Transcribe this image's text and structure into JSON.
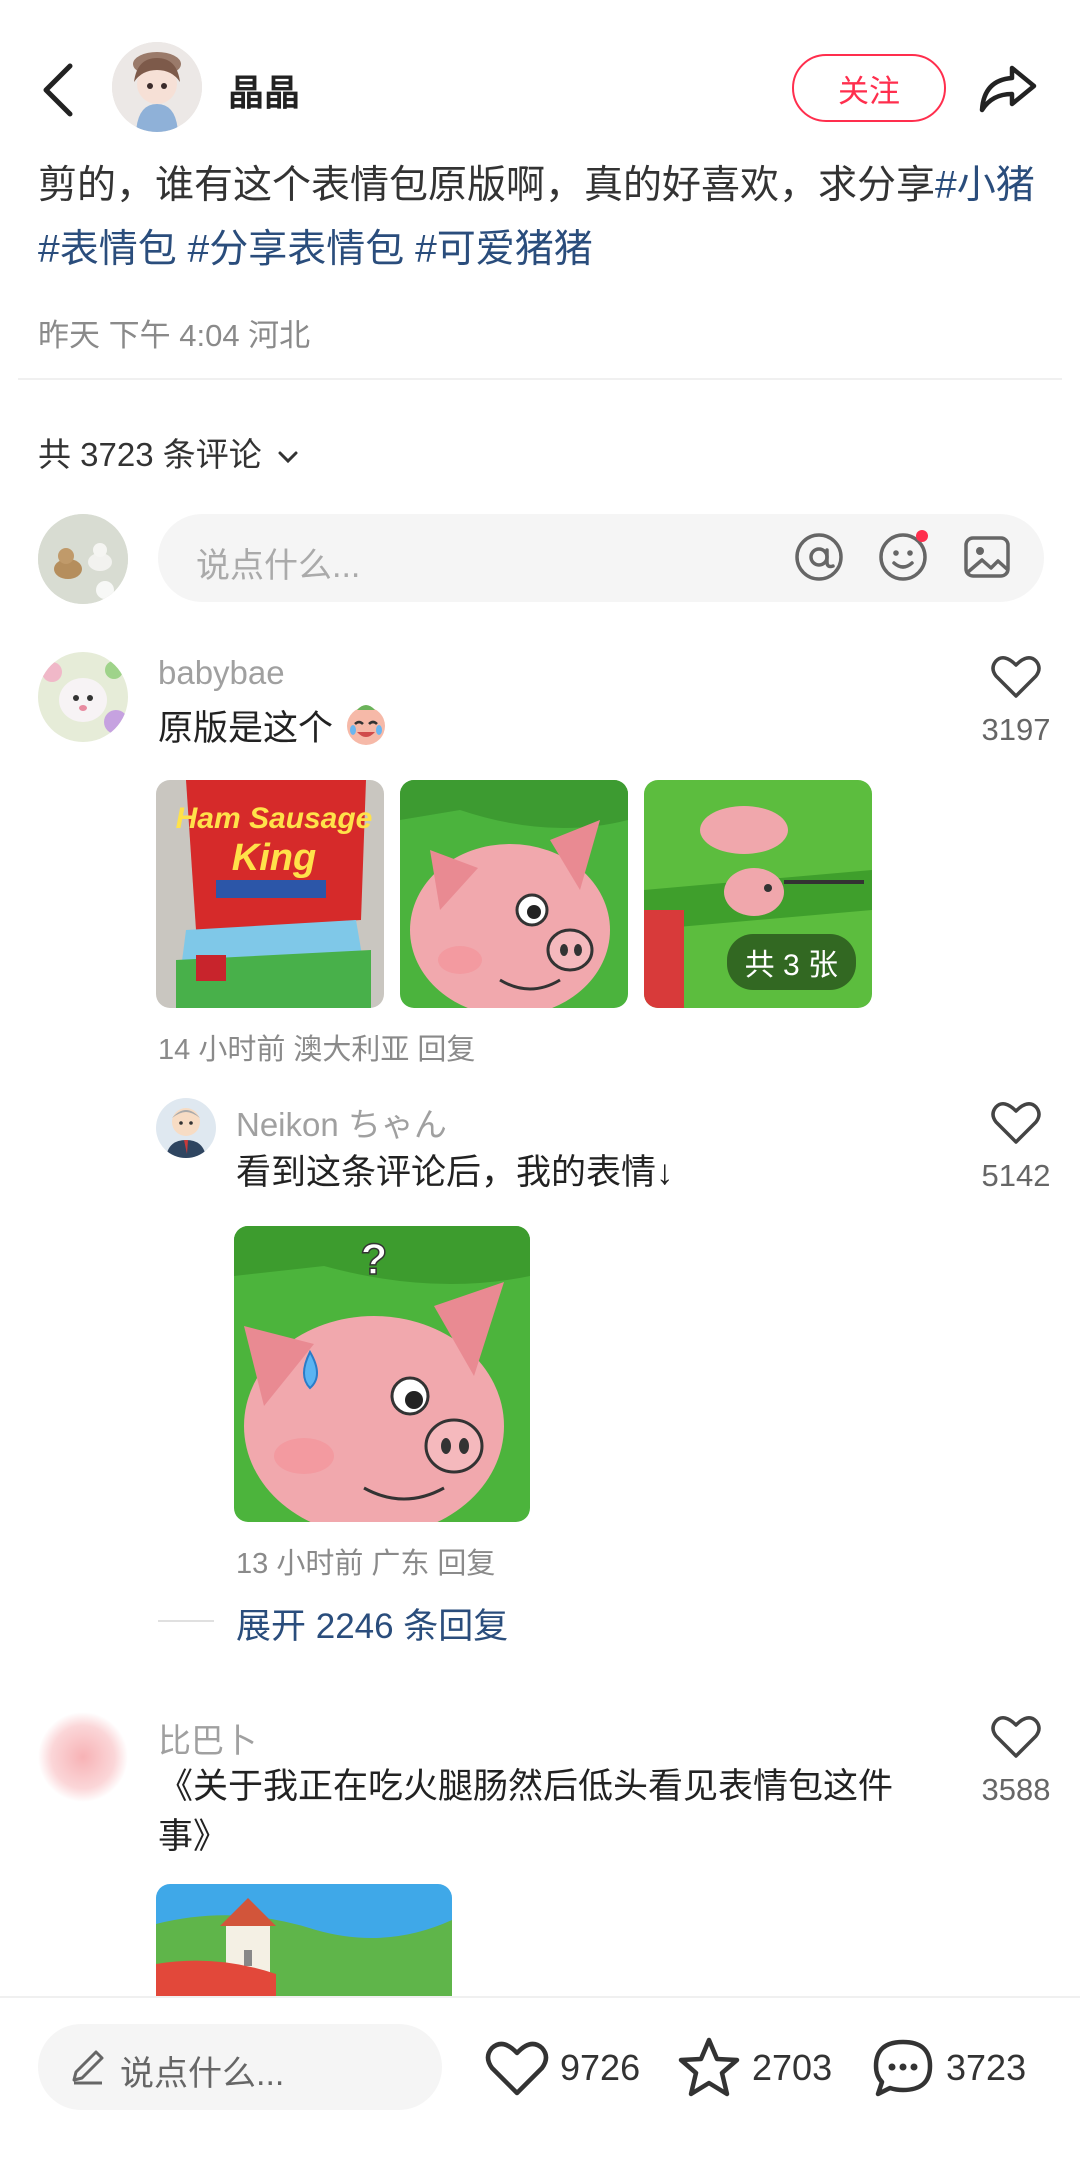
{
  "header": {
    "author_name": "晶晶",
    "follow_label": "关注",
    "back_icon": "back-chevron-icon",
    "share_icon": "share-arrow-icon"
  },
  "post": {
    "text": "剪的，谁有这个表情包原版啊，真的好喜欢，求分享",
    "tags": [
      "#小猪",
      "#表情包",
      "#分享表情包",
      "#可爱猪猪"
    ],
    "meta": "昨天 下午 4:04 河北"
  },
  "comments_header": {
    "count_label": "共 3723 条评论",
    "input_placeholder": "说点什么..."
  },
  "comments": [
    {
      "user": "babybae",
      "text": "原版是这个",
      "likes": "3197",
      "meta": "14 小时前 澳大利亚 回复",
      "images_badge": "共 3 张",
      "images": [
        {
          "name": "ham-sausage-package",
          "label_top": "Ham Sausage",
          "label_bottom": "King"
        },
        {
          "name": "pink-pig-closeup"
        },
        {
          "name": "pig-package-side"
        }
      ]
    },
    {
      "user": "Neikon ちゃん",
      "text": "看到这条评论后，我的表情↓",
      "likes": "5142",
      "meta": "13 小时前 广东 回复",
      "image_mark": "?"
    },
    {
      "user": "比巴卜",
      "text": "《关于我正在吃火腿肠然后低头看见表情包这件事》",
      "likes": "3588"
    }
  ],
  "expand_replies": "展开 2246 条回复",
  "bottom_bar": {
    "placeholder": "说点什么...",
    "likes": "9726",
    "stars": "2703",
    "comments": "3723"
  },
  "colors": {
    "accent_red": "#ff2e4d",
    "tag_blue": "#2a4d7c",
    "muted_gray": "#8a8a8a"
  }
}
